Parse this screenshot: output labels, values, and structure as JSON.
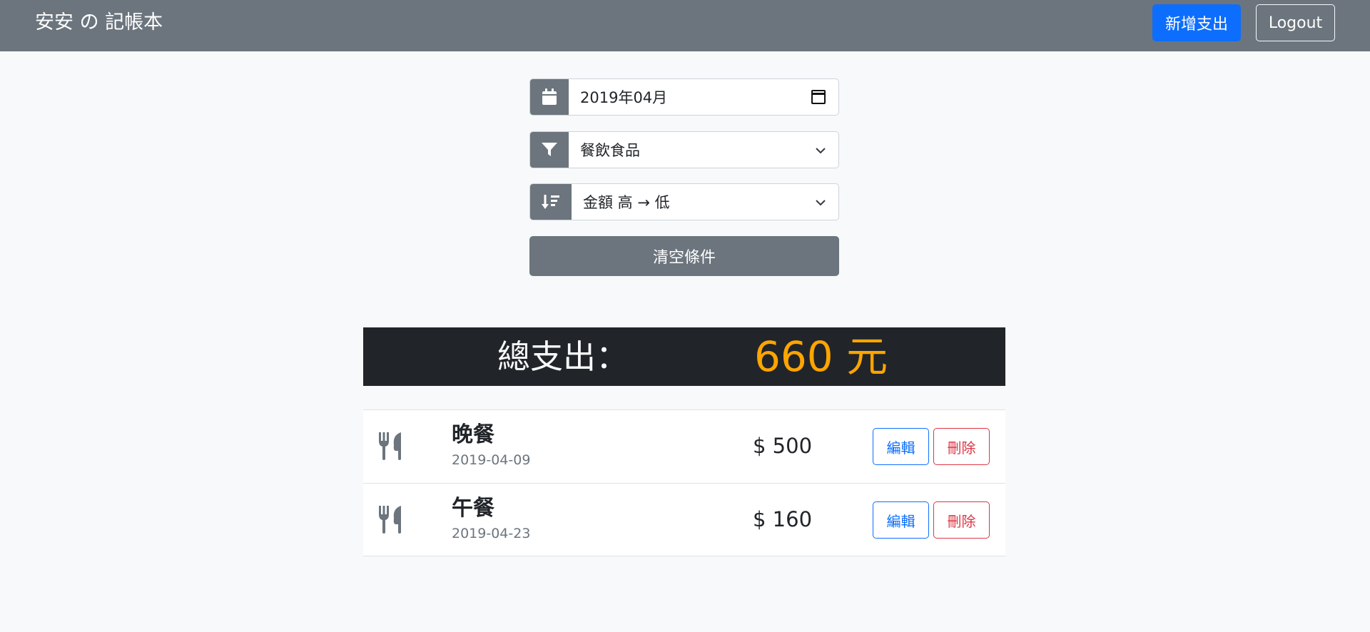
{
  "navbar": {
    "brand": "安安 の 記帳本",
    "new_expense_label": "新增支出",
    "logout_label": "Logout"
  },
  "filters": {
    "month": {
      "value": "2019年04月",
      "icon": "calendar-icon"
    },
    "category": {
      "value": "餐飲食品",
      "icon": "filter-icon"
    },
    "sort": {
      "value": "金額 高 → 低",
      "icon": "sort-amount-down-icon"
    },
    "clear_label": "清空條件"
  },
  "summary": {
    "label": "總支出：",
    "total": "660 元"
  },
  "records": [
    {
      "name": "晚餐",
      "date": "2019-04-09",
      "amount": "$ 500",
      "icon": "utensils-icon",
      "edit_label": "編輯",
      "delete_label": "刪除"
    },
    {
      "name": "午餐",
      "date": "2019-04-23",
      "amount": "$ 160",
      "icon": "utensils-icon",
      "edit_label": "編輯",
      "delete_label": "刪除"
    }
  ],
  "colors": {
    "navbar": "#6c757d",
    "primary": "#0d6efd",
    "danger": "#dc3545",
    "total_bar": "#212529",
    "total_value": "#ffa500"
  }
}
